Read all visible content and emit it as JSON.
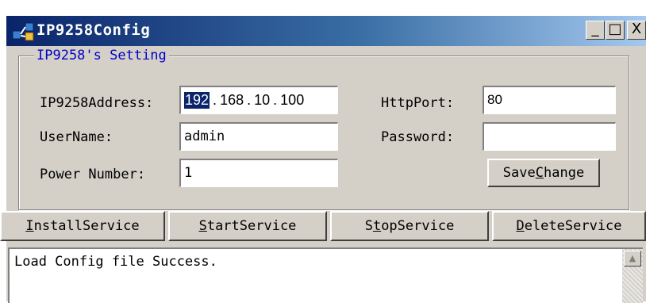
{
  "window": {
    "title": "IP9258Config",
    "controls": {
      "minimize": "_",
      "maximize": "□",
      "close": "X"
    }
  },
  "settings": {
    "group_title": "IP9258's Setting",
    "ip_label": "IP9258Address:",
    "ip": [
      "192",
      "168",
      "10",
      "100"
    ],
    "ip_selected_octet": "192",
    "http_port_label": "HttpPort:",
    "http_port": "80",
    "username_label": "UserName:",
    "username": "admin",
    "password_label": "Password:",
    "password": "",
    "power_number_label": "Power Number:",
    "power_number": "1",
    "save_change_label_pre": "Save",
    "save_change_label_mnemonic": "C",
    "save_change_label_post": "hange"
  },
  "actions": [
    {
      "pre": "",
      "mnemonic": "I",
      "post": "nstallService"
    },
    {
      "pre": "",
      "mnemonic": "S",
      "post": "tartService"
    },
    {
      "pre": "S",
      "mnemonic": "t",
      "post": "opService"
    },
    {
      "pre": "",
      "mnemonic": "D",
      "post": "eleteService"
    }
  ],
  "log": {
    "text": "Load Config file Success.",
    "scroll_up_arrow": "▲"
  }
}
